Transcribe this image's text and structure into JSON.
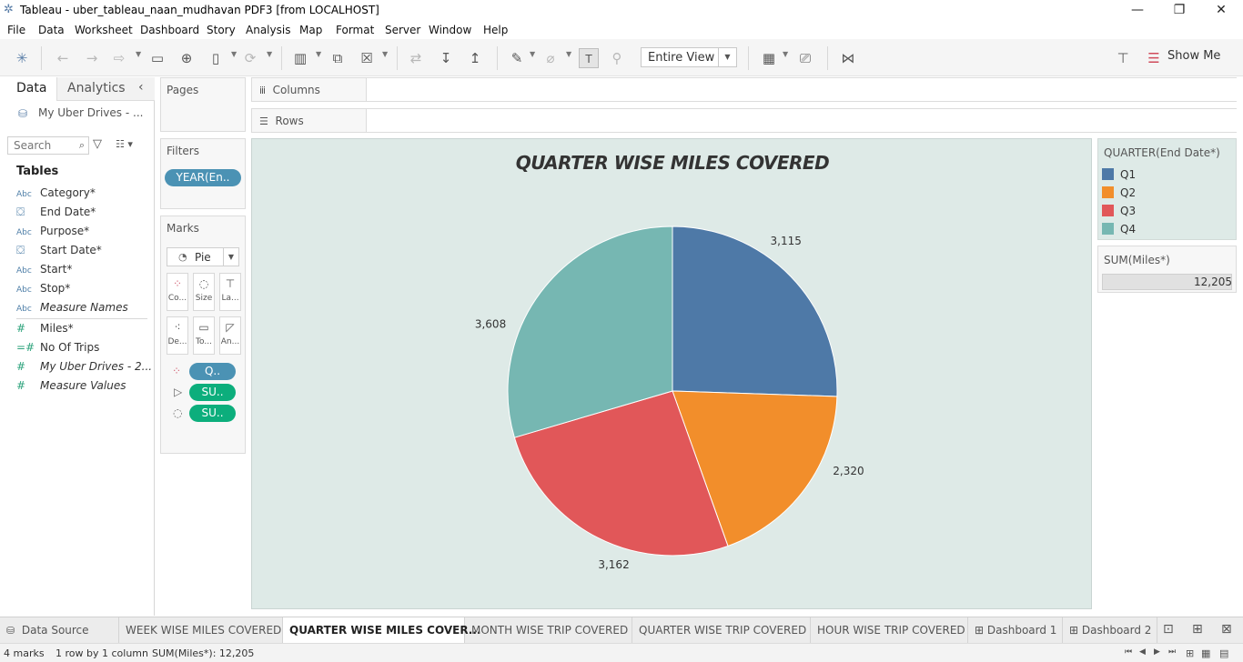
{
  "window": {
    "title": "Tableau - uber_tableau_naan_mudhavan PDF3 [from LOCALHOST]",
    "controls": [
      "—",
      "❐",
      "✕"
    ]
  },
  "menu": [
    "File",
    "Data",
    "Worksheet",
    "Dashboard",
    "Story",
    "Analysis",
    "Map",
    "Format",
    "Server",
    "Window",
    "Help"
  ],
  "toolbar": {
    "fit_label": "Entire View",
    "show_me_label": "Show Me"
  },
  "data_pane": {
    "tab_data": "Data",
    "tab_analytics": "Analytics",
    "datasource": "My Uber Drives - ...",
    "search_placeholder": "Search",
    "tables_heading": "Tables",
    "fields": [
      {
        "icon": "Abc",
        "name": "Category*"
      },
      {
        "icon": "date",
        "name": "End Date*"
      },
      {
        "icon": "Abc",
        "name": "Purpose*"
      },
      {
        "icon": "date",
        "name": "Start Date*"
      },
      {
        "icon": "Abc",
        "name": "Start*"
      },
      {
        "icon": "Abc",
        "name": "Stop*"
      },
      {
        "icon": "Abc",
        "name": "Measure Names"
      },
      {
        "icon": "#",
        "name": "Miles*"
      },
      {
        "icon": "#",
        "name": "No Of Trips"
      },
      {
        "icon": "#",
        "name": "My Uber Drives - 2..."
      },
      {
        "icon": "#",
        "name": "Measure Values"
      }
    ]
  },
  "pages_label": "Pages",
  "filters": {
    "label": "Filters",
    "pill": "YEAR(En.."
  },
  "marks": {
    "label": "Marks",
    "type": "Pie",
    "buttons": [
      "Co...",
      "Size",
      "La...",
      "De...",
      "To...",
      "An..."
    ],
    "pills": [
      "Q..",
      "SU..",
      "SU.."
    ]
  },
  "columns_label": "Columns",
  "rows_label": "Rows",
  "chart_data": {
    "type": "pie",
    "title": "QUARTER WISE MILES COVERED",
    "categories": [
      "Q1",
      "Q2",
      "Q3",
      "Q4"
    ],
    "values": [
      3115,
      2320,
      3162,
      3608
    ],
    "value_labels": [
      "3,115",
      "2,320",
      "3,162",
      "3,608"
    ],
    "colors": [
      "#4e79a7",
      "#f28e2b",
      "#e15759",
      "#76b7b2"
    ],
    "legend_title": "QUARTER(End Date*)",
    "legend_position": "right",
    "total_label": "SUM(Miles*)",
    "total_value": "12,205"
  },
  "sheet_tabs": [
    "Data Source",
    "WEEK WISE MILES COVERED",
    "QUARTER WISE MILES COVER...",
    "MONTH WISE TRIP COVERED",
    "QUARTER WISE TRIP COVERED",
    "HOUR WISE TRIP COVERED",
    "Dashboard 1",
    "Dashboard 2"
  ],
  "status": {
    "marks": "4 marks",
    "rows": "1 row by 1 column",
    "sum": "SUM(Miles*): 12,205"
  }
}
